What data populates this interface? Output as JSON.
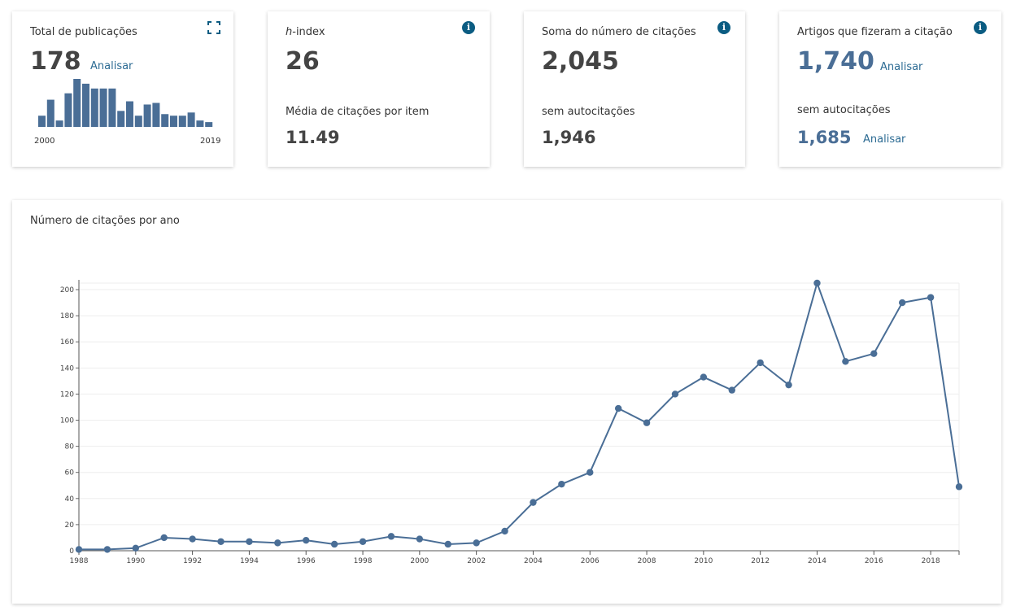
{
  "cards": {
    "publications": {
      "title": "Total de publicações",
      "value": "178",
      "link": "Analisar",
      "year_start": "2000",
      "year_end": "2019",
      "bars": [
        7,
        17,
        4,
        21,
        30,
        27,
        24,
        24,
        24,
        10,
        16,
        7,
        14,
        15,
        8,
        7,
        7,
        9,
        4,
        3
      ]
    },
    "hindex": {
      "title_italic": "h",
      "title_rest": "-index",
      "value": "26",
      "sub_label": "Média de citações por item",
      "sub_value": "11.49"
    },
    "citations": {
      "title": "Soma do número de citações",
      "value": "2,045",
      "sub_label": "sem autocitações",
      "sub_value": "1,946"
    },
    "citing": {
      "title": "Artigos que fizeram a citação",
      "value": "1,740",
      "link": "Analisar",
      "sub_label": "sem autocitações",
      "sub_value": "1,685",
      "sub_link": "Analisar"
    },
    "info_glyph": "i"
  },
  "colors": {
    "series": "#4a6e96",
    "accent_link": "#2c6b93",
    "info": "#0b5c82"
  },
  "chart_data": {
    "type": "line",
    "title": "Número de citações por ano",
    "xlabel": "",
    "ylabel": "",
    "x": [
      1988,
      1989,
      1990,
      1991,
      1992,
      1993,
      1994,
      1995,
      1996,
      1997,
      1998,
      1999,
      2000,
      2001,
      2002,
      2003,
      2004,
      2005,
      2006,
      2007,
      2008,
      2009,
      2010,
      2011,
      2012,
      2013,
      2014,
      2015,
      2016,
      2017,
      2018,
      2019
    ],
    "series": [
      {
        "values": [
          1,
          1,
          2,
          10,
          9,
          7,
          7,
          6,
          8,
          5,
          7,
          11,
          9,
          5,
          6,
          15,
          37,
          51,
          60,
          109,
          98,
          120,
          133,
          123,
          144,
          127,
          205,
          145,
          151,
          190,
          194,
          49
        ]
      }
    ],
    "xlim": [
      1988,
      2019
    ],
    "ylim": [
      0,
      205
    ],
    "yticks": [
      0,
      20,
      40,
      60,
      80,
      100,
      120,
      140,
      160,
      180,
      200
    ],
    "xticks": [
      1988,
      1990,
      1992,
      1994,
      1996,
      1998,
      2000,
      2002,
      2004,
      2006,
      2008,
      2010,
      2012,
      2014,
      2016,
      2018
    ],
    "grid": true,
    "legend": "none"
  }
}
